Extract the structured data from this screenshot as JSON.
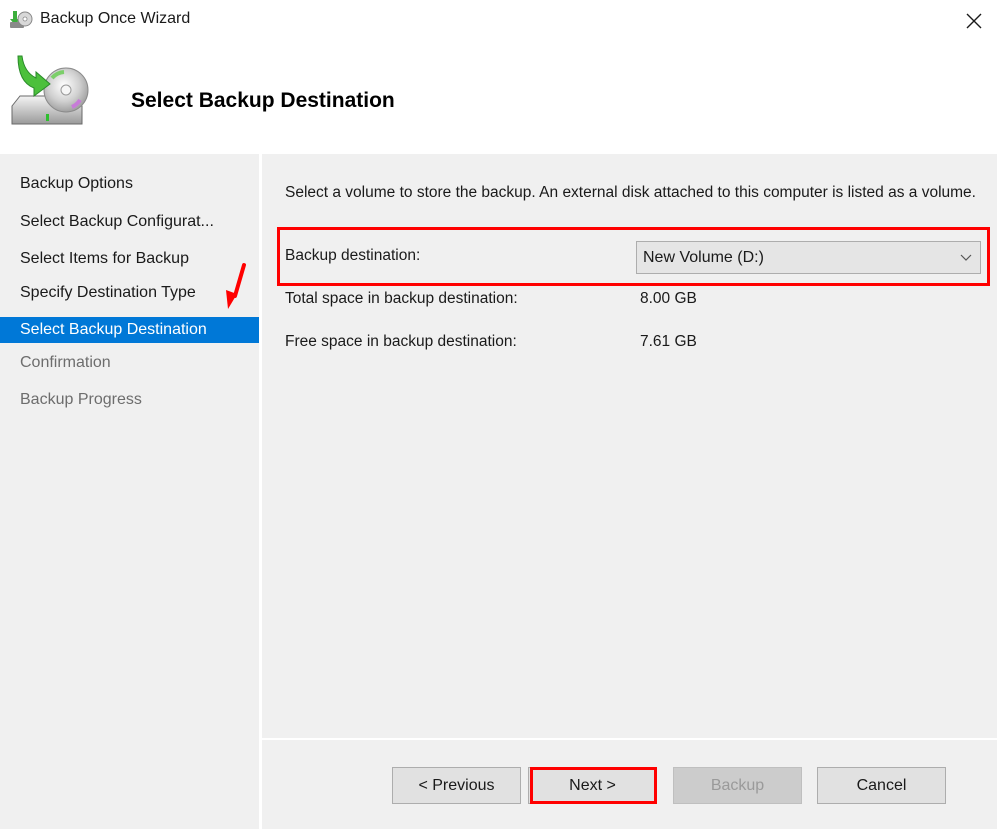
{
  "window": {
    "title": "Backup Once Wizard",
    "app_icon": "backup-disk-icon",
    "close_icon": "close-icon"
  },
  "header": {
    "icon": "backup-drive-disc-icon",
    "title": "Select Backup Destination"
  },
  "steps": [
    {
      "label": "Backup Options",
      "state": "completed"
    },
    {
      "label": "Select Backup Configurat...",
      "state": "completed"
    },
    {
      "label": "Select Items for Backup",
      "state": "completed"
    },
    {
      "label": "Specify Destination Type",
      "state": "completed"
    },
    {
      "label": "Select Backup Destination",
      "state": "active"
    },
    {
      "label": "Confirmation",
      "state": "disabled"
    },
    {
      "label": "Backup Progress",
      "state": "disabled"
    }
  ],
  "content": {
    "description": "Select a volume to store the backup. An external disk attached to this computer is listed as a volume.",
    "destination_label": "Backup destination:",
    "destination_value": "New Volume (D:)",
    "total_space_label": "Total space in backup destination:",
    "total_space_value": "8.00 GB",
    "free_space_label": "Free space in backup destination:",
    "free_space_value": "7.61 GB"
  },
  "buttons": {
    "previous": "< Previous",
    "next": "Next >",
    "backup": "Backup",
    "cancel": "Cancel"
  },
  "annotations": {
    "highlight_color": "#ff0000",
    "active_step_color": "#0078d7"
  }
}
